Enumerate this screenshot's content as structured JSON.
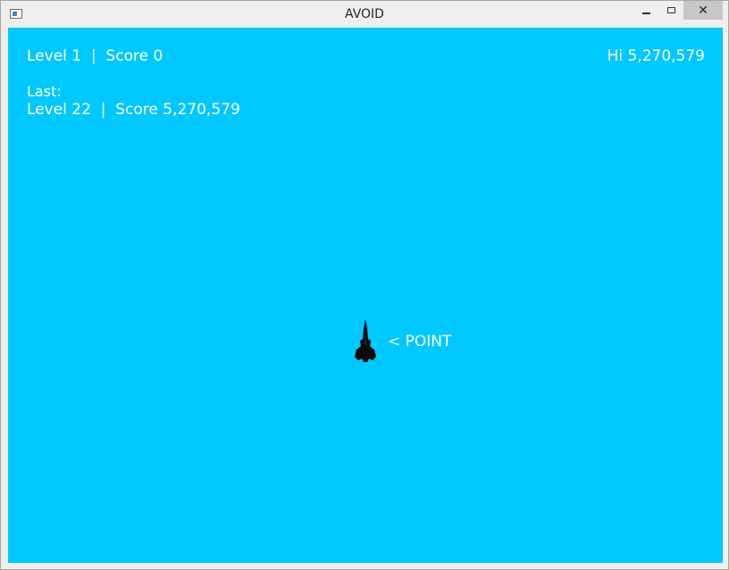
{
  "window": {
    "title": "AVOID",
    "close_glyph": "✕"
  },
  "hud": {
    "current": "Level 1  |  Score 0",
    "hi": "Hi 5,270,579",
    "last_label": "Last:",
    "last": "Level 22  |  Score 5,270,579"
  },
  "game": {
    "background_color": "#00c8ff",
    "ship_icon": "spaceship-icon",
    "point_label": "< POINT"
  }
}
